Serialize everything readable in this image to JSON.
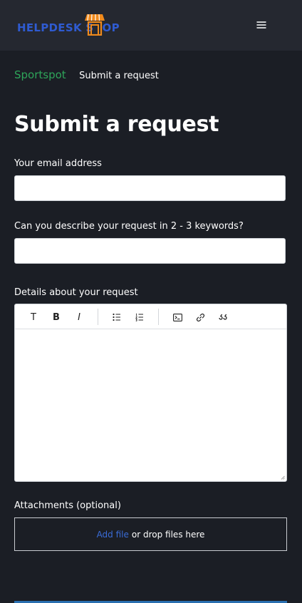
{
  "header": {
    "logo_text_left": "HELPDESK S",
    "logo_text_right": "OP",
    "brand_colors": {
      "logo_text": "#2f5bd1",
      "logo_house": "#f08a1c"
    },
    "menu_icon": "hamburger-icon"
  },
  "breadcrumb": {
    "parent": "Sportspot",
    "current": "Submit a request"
  },
  "page_title": "Submit a request",
  "form": {
    "email_label": "Your email address",
    "email_value": "",
    "keywords_label": "Can you describe your request in 2 - 3 keywords?",
    "keywords_value": "",
    "details_label": "Details about your request",
    "toolbar": {
      "text_btn": "T",
      "bold_btn": "B",
      "italic_btn": "I",
      "icons": [
        "bulleted-list-icon",
        "numbered-list-icon",
        "code-block-icon",
        "link-icon",
        "quote-icon"
      ]
    },
    "attachments_label": "Attachments (optional)",
    "add_file": "Add file",
    "drop_text": "or drop files here"
  },
  "colors": {
    "background": "#1b1e25",
    "header": "#252830",
    "breadcrumb_link": "#2ea55a",
    "add_file_link": "#3a6cd8",
    "submit_button": "#2a6fb0"
  }
}
